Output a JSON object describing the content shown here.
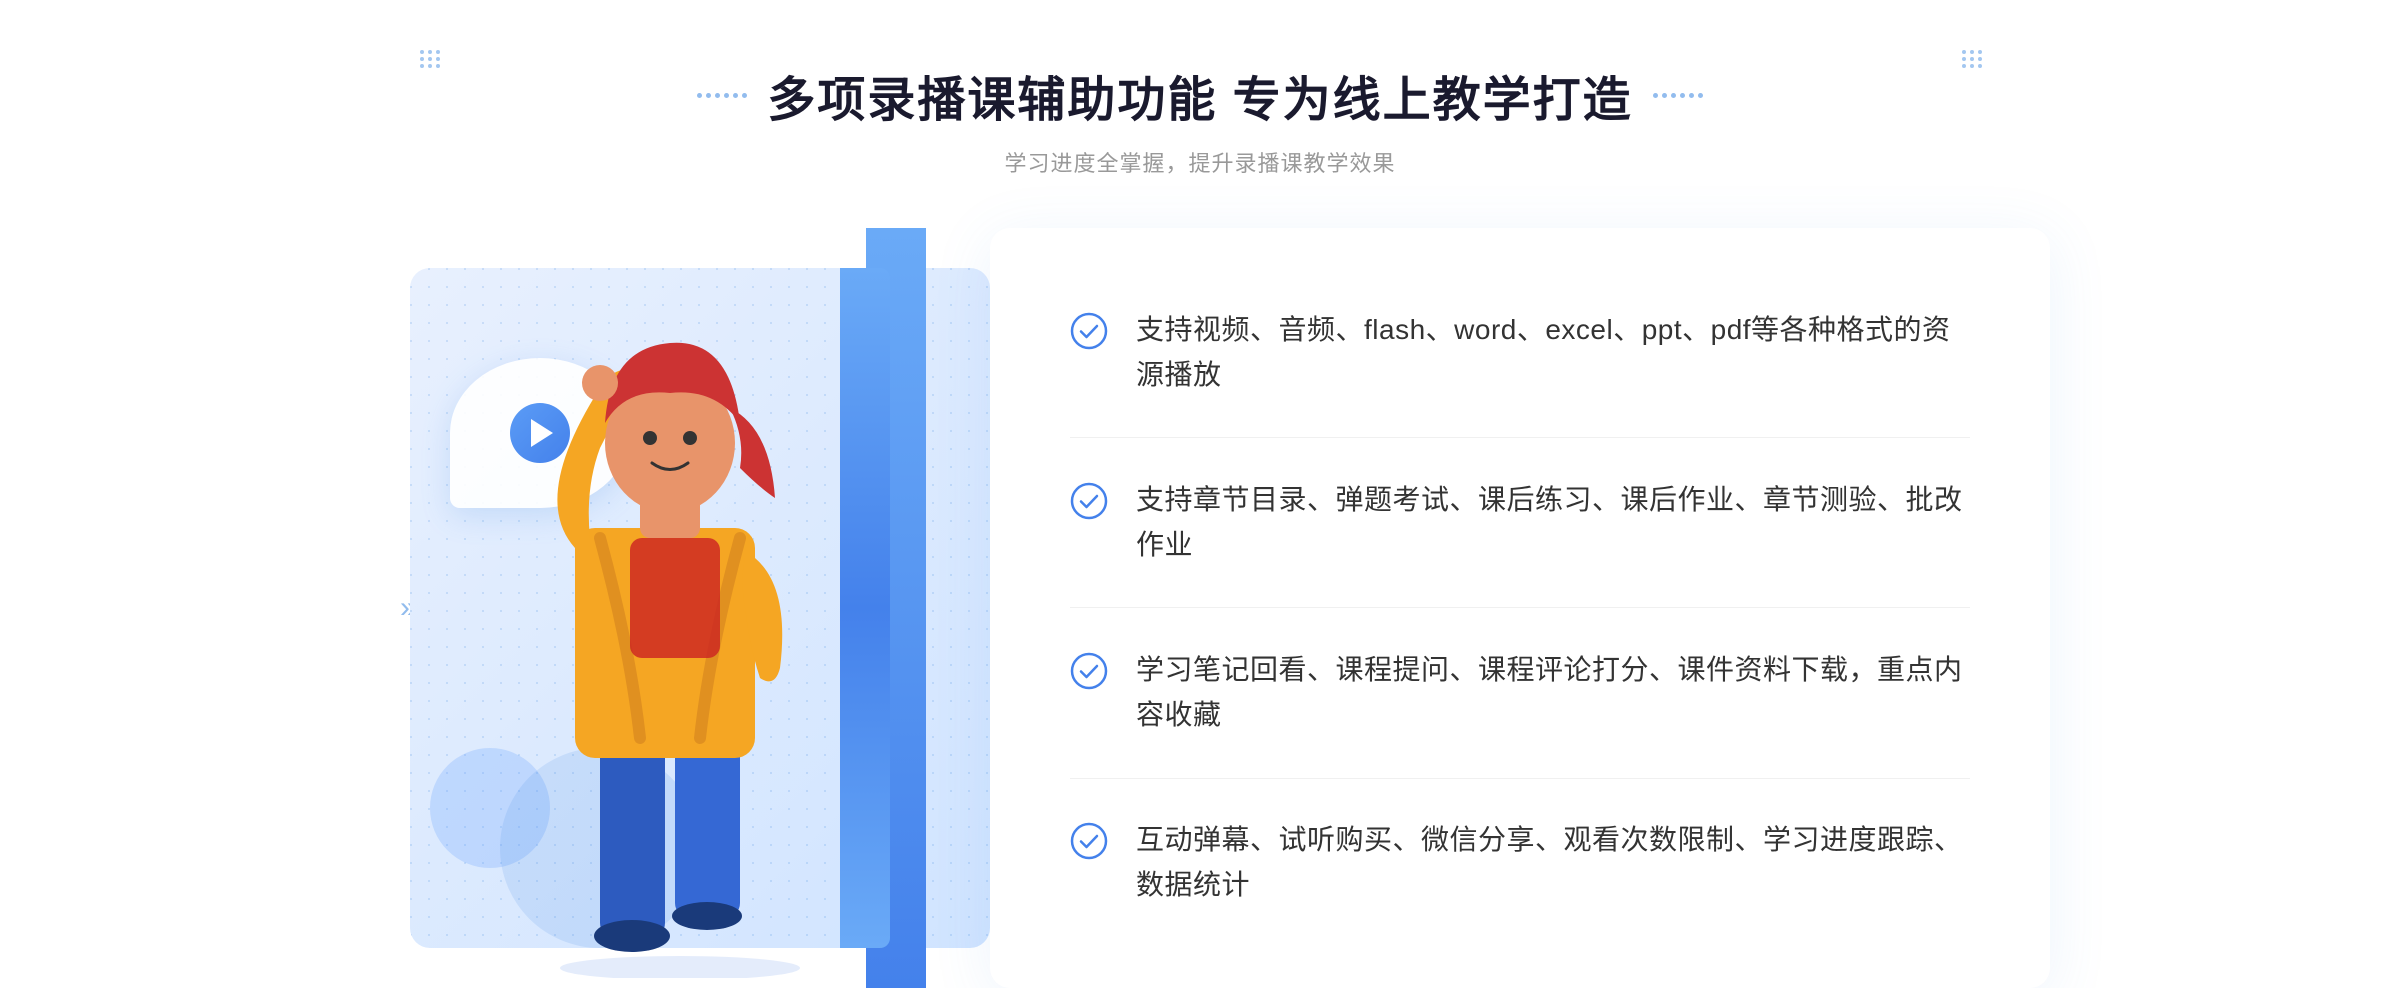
{
  "header": {
    "title": "多项录播课辅助功能 专为线上教学打造",
    "subtitle": "学习进度全掌握，提升录播课教学效果"
  },
  "features": [
    {
      "id": 1,
      "text": "支持视频、音频、flash、word、excel、ppt、pdf等各种格式的资源播放"
    },
    {
      "id": 2,
      "text": "支持章节目录、弹题考试、课后练习、课后作业、章节测验、批改作业"
    },
    {
      "id": 3,
      "text": "学习笔记回看、课程提问、课程评论打分、课件资料下载，重点内容收藏"
    },
    {
      "id": 4,
      "text": "互动弹幕、试听购买、微信分享、观看次数限制、学习进度跟踪、数据统计"
    }
  ],
  "colors": {
    "accent": "#4481eb",
    "light_blue": "#5b9cf6",
    "text_dark": "#1a1a2e",
    "text_light": "#999999",
    "text_body": "#333333"
  },
  "icons": {
    "check": "check-circle-icon",
    "play": "play-icon",
    "chevron_left": "chevron-left-icon",
    "dots": "dots-decoration-icon"
  }
}
